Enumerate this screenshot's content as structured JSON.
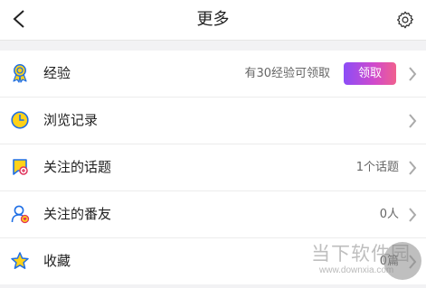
{
  "header": {
    "title": "更多",
    "back_icon": "chevron-left-icon",
    "settings_icon": "gear-icon"
  },
  "colors": {
    "accent_gradient_start": "#8c4df7",
    "accent_gradient_end": "#f0608e",
    "icon_blue": "#1f6fe5",
    "icon_yellow": "#ffd21a"
  },
  "items": [
    {
      "label": "经验",
      "right_text": "有30经验可领取",
      "action_label": "领取",
      "icon": "medal-icon"
    },
    {
      "label": "浏览记录",
      "right_text": "",
      "icon": "clock-icon"
    },
    {
      "label": "关注的话题",
      "right_text": "1个话题",
      "icon": "topic-flag-icon"
    },
    {
      "label": "关注的番友",
      "right_text": "0人",
      "icon": "user-heart-icon"
    },
    {
      "label": "收藏",
      "right_text": "0篇",
      "icon": "star-icon"
    }
  ],
  "watermark": {
    "text": "当下软件园",
    "url": "www.downxia.com"
  }
}
